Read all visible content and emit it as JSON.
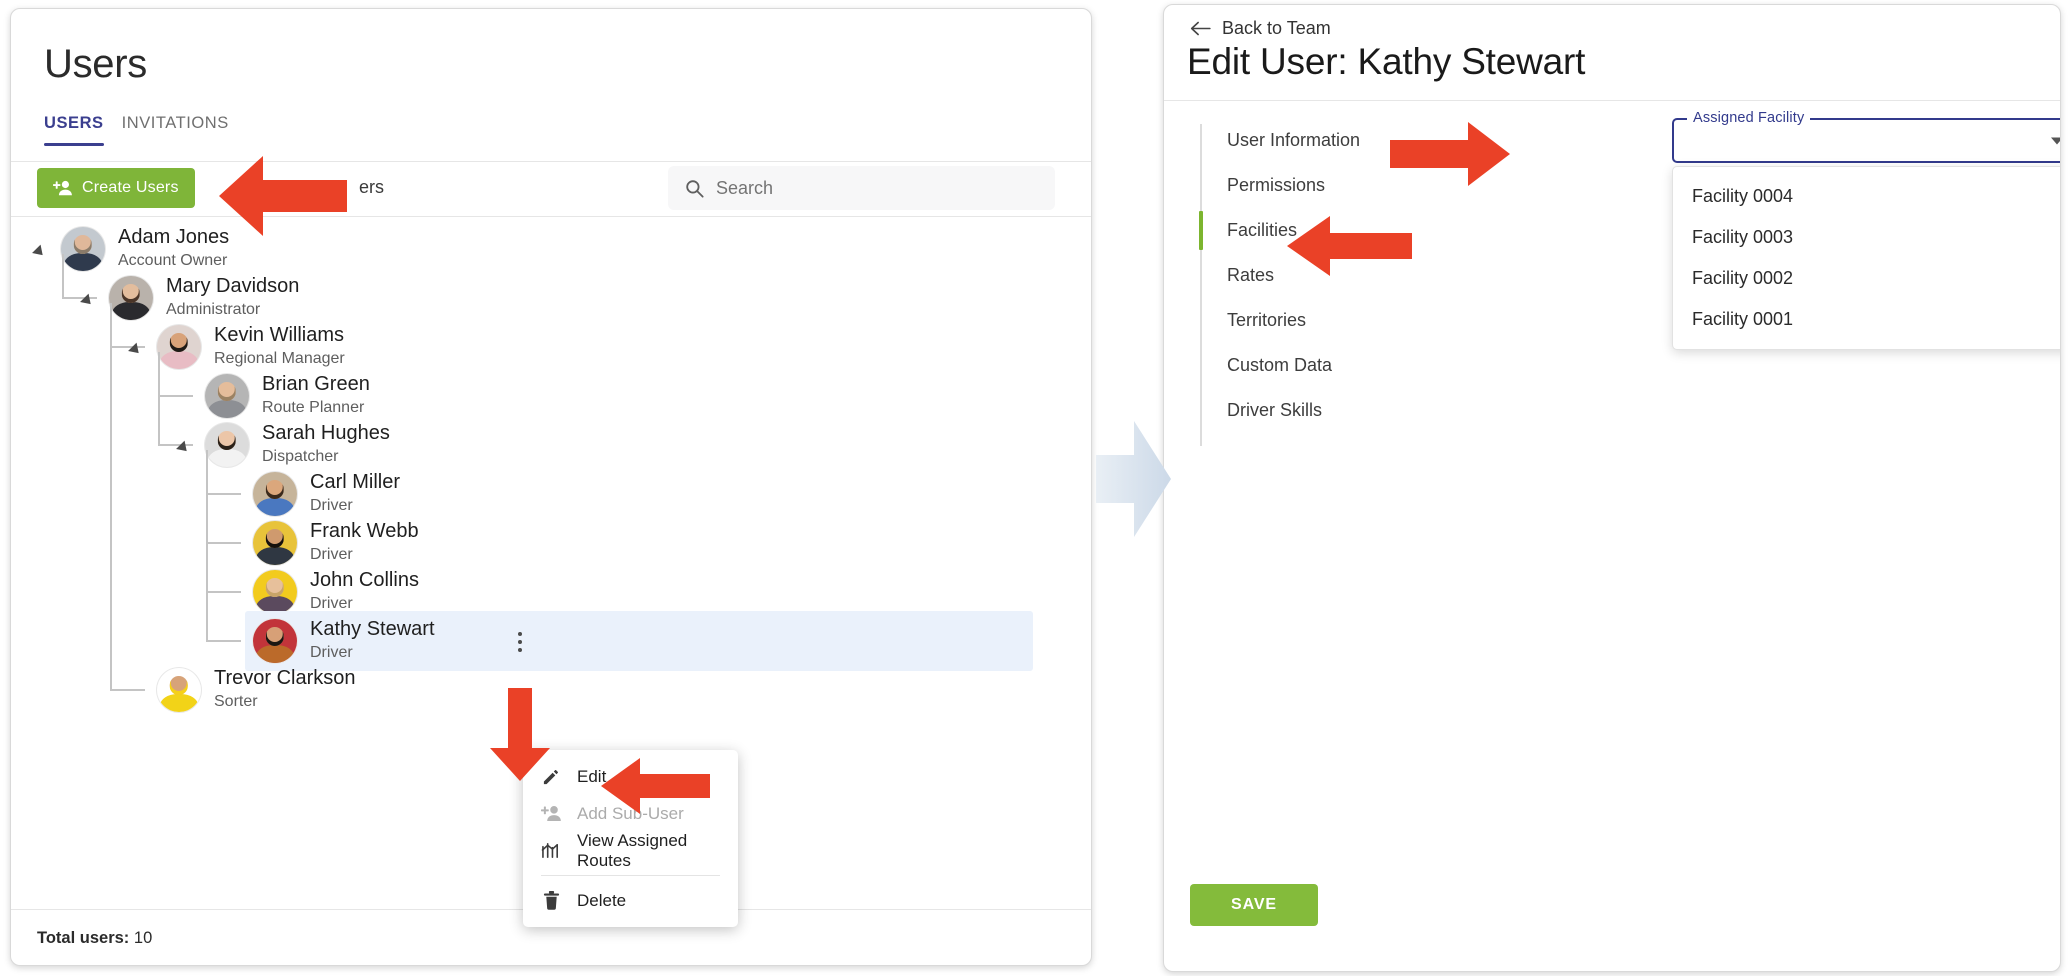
{
  "left_panel": {
    "title": "Users",
    "tabs": [
      {
        "label": "USERS",
        "active": true
      },
      {
        "label": "INVITATIONS",
        "active": false
      }
    ],
    "create_button": {
      "label": "Create Users",
      "icon": "add-user-icon",
      "color": "#7fb539"
    },
    "obscured_toolbar_text": "ers",
    "search": {
      "placeholder": "Search",
      "icon": "search-icon"
    },
    "footer": {
      "label": "Total users:",
      "value": "10"
    },
    "tree": [
      {
        "name": "Adam Jones",
        "role": "Account Owner",
        "depth": 0,
        "expanded": true,
        "highlighted": false,
        "avatar_skin": "#e0b89a",
        "avatar_cloth": "#2f3a4d",
        "avatar_hair": "#8a7b6a",
        "avatar_bg": "#c3c9cf"
      },
      {
        "name": "Mary Davidson",
        "role": "Administrator",
        "depth": 1,
        "expanded": true,
        "highlighted": false,
        "avatar_skin": "#e3bd9d",
        "avatar_cloth": "#2a2a2e",
        "avatar_hair": "#4a3528",
        "avatar_bg": "#b9b2ab"
      },
      {
        "name": "Kevin Williams",
        "role": "Regional Manager",
        "depth": 2,
        "expanded": true,
        "highlighted": false,
        "avatar_skin": "#d8a279",
        "avatar_cloth": "#e8bcc4",
        "avatar_hair": "#1f1a16",
        "avatar_bg": "#dfd4d0"
      },
      {
        "name": "Brian Green",
        "role": "Route Planner",
        "depth": 3,
        "expanded": false,
        "highlighted": false,
        "avatar_skin": "#e5bd9b",
        "avatar_cloth": "#8d8f94",
        "avatar_hair": "#9b8263",
        "avatar_bg": "#b5b5b5"
      },
      {
        "name": "Sarah Hughes",
        "role": "Dispatcher",
        "depth": 3,
        "expanded": true,
        "highlighted": false,
        "avatar_skin": "#ecc6a8",
        "avatar_cloth": "#f2f2f2",
        "avatar_hair": "#2b2118",
        "avatar_bg": "#dcdcdc"
      },
      {
        "name": "Carl Miller",
        "role": "Driver",
        "depth": 4,
        "expanded": false,
        "highlighted": false,
        "avatar_skin": "#dba77c",
        "avatar_cloth": "#4a78c0",
        "avatar_hair": "#3a2a1c",
        "avatar_bg": "#c6b49a"
      },
      {
        "name": "Frank Webb",
        "role": "Driver",
        "depth": 4,
        "expanded": false,
        "highlighted": false,
        "avatar_skin": "#cf9a6e",
        "avatar_cloth": "#2f3742",
        "avatar_hair": "#15110d",
        "avatar_bg": "#e8c33a"
      },
      {
        "name": "John Collins",
        "role": "Driver",
        "depth": 4,
        "expanded": false,
        "highlighted": false,
        "avatar_skin": "#e7c09b",
        "avatar_cloth": "#5b4a5e",
        "avatar_hair": "#c8a468",
        "avatar_bg": "#f2cb1e"
      },
      {
        "name": "Kathy Stewart",
        "role": "Driver",
        "depth": 4,
        "expanded": false,
        "highlighted": true,
        "avatar_skin": "#d7a077",
        "avatar_cloth": "#bb6a2a",
        "avatar_hair": "#1c1712",
        "avatar_bg": "#c2343a"
      },
      {
        "name": "Trevor Clarkson",
        "role": "Sorter",
        "depth": 2,
        "expanded": false,
        "highlighted": false,
        "avatar_skin": "#d7a379",
        "avatar_cloth": "#f2d318",
        "avatar_hair": "#f5d118",
        "avatar_bg": "#ffffff"
      }
    ]
  },
  "context_menu": {
    "items": [
      {
        "label": "Edit",
        "icon": "pencil-icon",
        "disabled": false,
        "separator_after": false
      },
      {
        "label": "Add Sub-User",
        "icon": "add-user-icon",
        "disabled": true,
        "separator_after": false
      },
      {
        "label": "View Assigned Routes",
        "icon": "routes-icon",
        "disabled": false,
        "separator_after": true
      },
      {
        "label": "Delete",
        "icon": "trash-icon",
        "disabled": false,
        "separator_after": false
      }
    ]
  },
  "right_panel": {
    "back_link": {
      "label": "Back to Team",
      "icon": "arrow-left-icon"
    },
    "title": "Edit User: Kathy Stewart",
    "nav": [
      {
        "label": "User Information",
        "active": false
      },
      {
        "label": "Permissions",
        "active": false
      },
      {
        "label": "Facilities",
        "active": true
      },
      {
        "label": "Rates",
        "active": false
      },
      {
        "label": "Territories",
        "active": false
      },
      {
        "label": "Custom Data",
        "active": false
      },
      {
        "label": "Driver Skills",
        "active": false
      }
    ],
    "assigned_facility": {
      "label": "Assigned Facility",
      "value": "",
      "open": true,
      "options": [
        "Facility 0004",
        "Facility 0003",
        "Facility 0002",
        "Facility 0001"
      ]
    },
    "save_button": {
      "label": "SAVE",
      "color": "#84bb3b"
    }
  },
  "annotations": {
    "color": "#ea4127",
    "arrows": [
      {
        "target": "create-users-button",
        "direction": "left"
      },
      {
        "target": "edit-menu-item",
        "direction": "left"
      },
      {
        "target": "kathy-stewart-kebab",
        "direction": "down"
      },
      {
        "target": "assigned-facility-select",
        "direction": "right"
      },
      {
        "target": "facilities-nav-item",
        "direction": "left"
      }
    ],
    "flow_arrow": {
      "direction": "right",
      "color": "#d7e2ee"
    }
  }
}
